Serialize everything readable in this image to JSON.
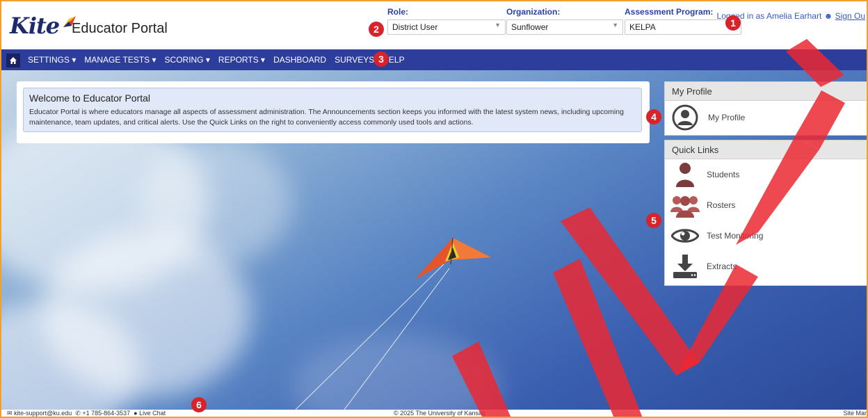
{
  "brand": {
    "logo_text": "Kite",
    "portal_title": "Educator Portal"
  },
  "header": {
    "role": {
      "label": "Role:",
      "value": "District User"
    },
    "organization": {
      "label": "Organization:",
      "value": "Sunflower"
    },
    "assessment_program": {
      "label": "Assessment Program:",
      "value": "KELPA"
    },
    "login_text": "Logged in as Amelia Earhart",
    "signout_text": "Sign Ou"
  },
  "nav": {
    "items": [
      "SETTINGS ▾",
      "MANAGE TESTS ▾",
      "SCORING ▾",
      "REPORTS ▾",
      "DASHBOARD",
      "SURVEYS",
      "HELP"
    ]
  },
  "welcome": {
    "title": "Welcome to Educator Portal",
    "text": "Educator Portal is where educators manage all aspects of assessment administration. The Announcements section keeps you informed with the latest system news, including upcoming maintenance, team updates, and critical alerts. Use the Quick Links on the right to conveniently access commonly used tools and actions."
  },
  "my_profile": {
    "heading": "My Profile",
    "link": "My Profile"
  },
  "quick_links": {
    "heading": "Quick Links",
    "items": [
      {
        "label": "Students",
        "icon": "student-icon"
      },
      {
        "label": "Rosters",
        "icon": "roster-icon"
      },
      {
        "label": "Test Monitoring",
        "icon": "eye-icon"
      },
      {
        "label": "Extracts",
        "icon": "download-icon"
      }
    ]
  },
  "badges": [
    "1",
    "2",
    "3",
    "4",
    "5",
    "6"
  ],
  "footer": {
    "email": "kite-support@ku.edu",
    "phone": "+1 785-864-3537",
    "chat": "Live Chat",
    "copyright": "© 2025 The University of Kansas",
    "sitemap": "Site Mar"
  },
  "colors": {
    "nav": "#2c3d9c",
    "badge": "#d8232a",
    "brand": "#1d2a6b",
    "link": "#3a5bc7"
  }
}
